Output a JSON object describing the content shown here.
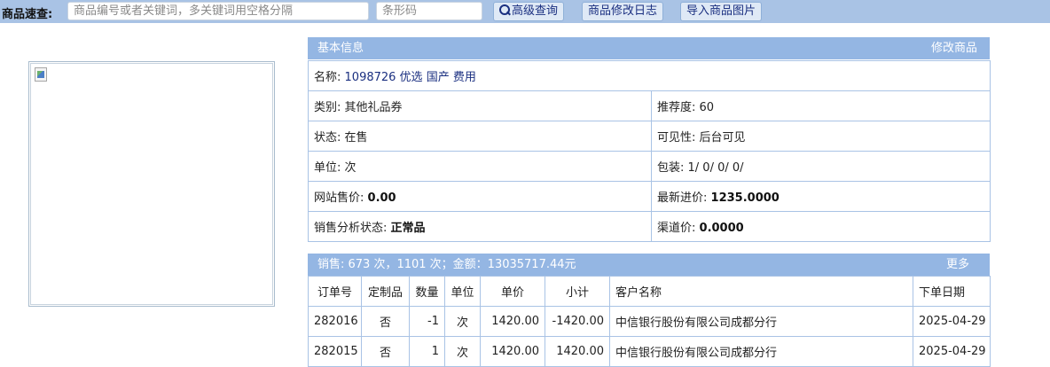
{
  "topbar": {
    "quick_label": "商品速查:",
    "keyword_placeholder": "商品编号或者关键词，多关键词用空格分隔",
    "barcode_placeholder": "条形码",
    "advanced_search_label": "高级查询",
    "change_log_label": "商品修改日志",
    "import_images_label": "导入商品图片"
  },
  "basic_info": {
    "header_title": "基本信息",
    "edit_label": "修改商品",
    "name_label": "名称:",
    "name_value": "1098726 优选 国产 费用",
    "category": "类别: 其他礼品券",
    "recommend": "推荐度: 60",
    "status": "状态:  在售",
    "visibility": "可见性:  后台可见",
    "unit": "单位: 次",
    "packaging": "包装:  1/ 0/ 0/ 0/",
    "web_price_label": "网站售价:",
    "web_price_value": "0.00",
    "latest_cost_label": "最新进价:",
    "latest_cost_value": "1235.0000",
    "sales_status_label": "销售分析状态:",
    "sales_status_value": "正常品",
    "channel_price_label": "渠道价:",
    "channel_price_value": "0.0000"
  },
  "sales": {
    "header_summary": "销售:  673 次，1101 次；金额：13035717.44元",
    "more_label": "更多",
    "columns": [
      "订单号",
      "定制品",
      "数量",
      "单位",
      "单价",
      "小计",
      "客户名称",
      "下单日期"
    ],
    "rows": [
      {
        "order_no": "282016",
        "custom": "否",
        "qty": "-1",
        "unit": "次",
        "price": "1420.00",
        "subtotal": "-1420.00",
        "customer": "中信银行股份有限公司成都分行",
        "date": "2025-04-29"
      },
      {
        "order_no": "282015",
        "custom": "否",
        "qty": "1",
        "unit": "次",
        "price": "1420.00",
        "subtotal": "1420.00",
        "customer": "中信银行股份有限公司成都分行",
        "date": "2025-04-29"
      }
    ]
  }
}
